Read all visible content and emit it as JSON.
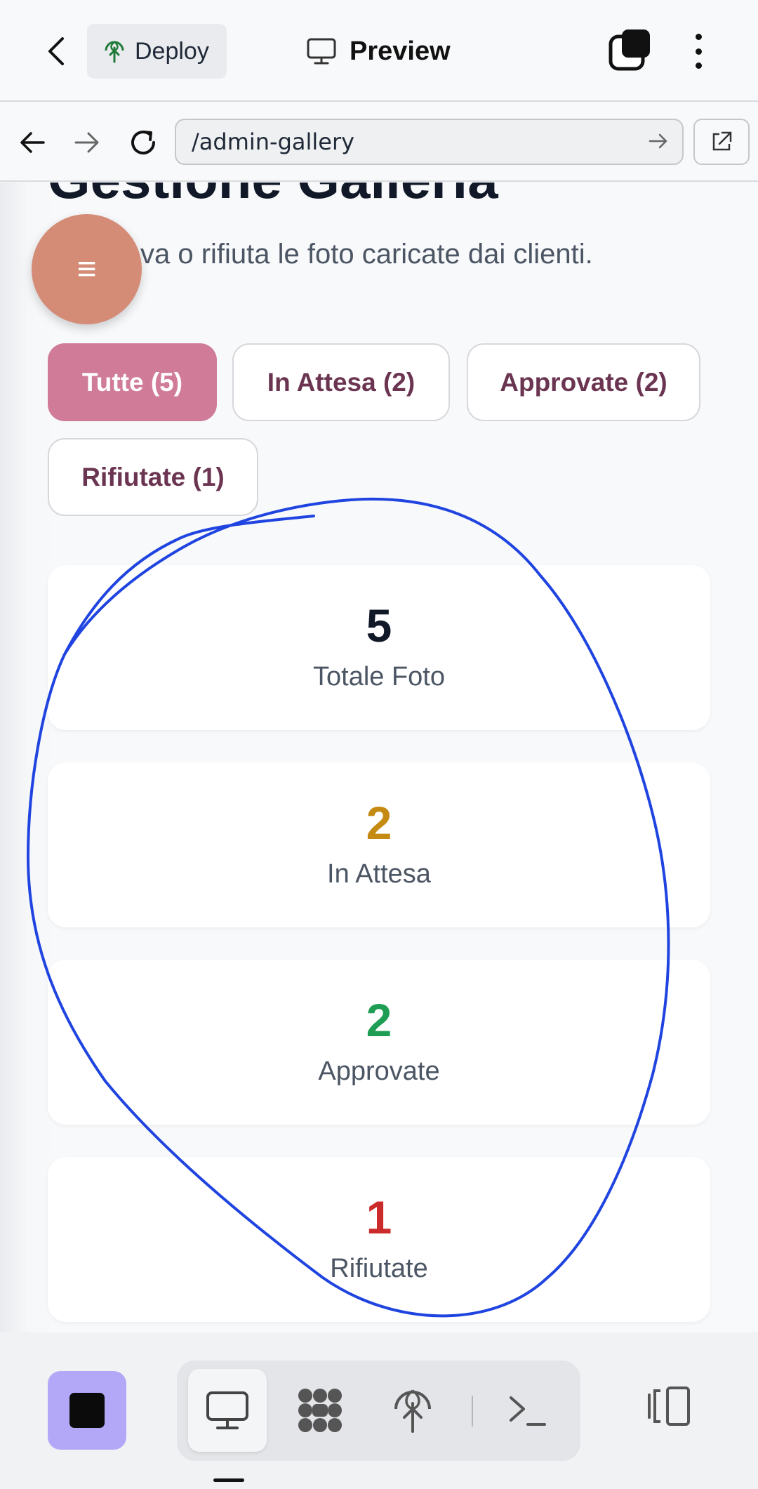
{
  "appbar": {
    "deploy_label": "Deploy",
    "preview_label": "Preview"
  },
  "urlbar": {
    "url": "/admin-gallery"
  },
  "page": {
    "title": "Gestione Galleria",
    "subtitle_visible": "va o rifiuta le foto caricate dai clienti."
  },
  "filters": [
    {
      "label": "Tutte (5)",
      "active": true
    },
    {
      "label": "In Attesa (2)",
      "active": false
    },
    {
      "label": "Approvate (2)",
      "active": false
    },
    {
      "label": "Rifiutate (1)",
      "active": false
    }
  ],
  "stats": [
    {
      "value": "5",
      "label": "Totale Foto",
      "color": "#111827"
    },
    {
      "value": "2",
      "label": "In Attesa",
      "color": "#c48a12"
    },
    {
      "value": "2",
      "label": "Approvate",
      "color": "#1f9d55"
    },
    {
      "value": "1",
      "label": "Rifiutate",
      "color": "#cc2b2b"
    }
  ],
  "colors": {
    "accent_pink": "#d07c99",
    "fab": "#d48c77",
    "annotation": "#1f44e0",
    "stop_button": "#b2a8f7"
  },
  "icons": {
    "menu": "≡",
    "terminal": ">_"
  }
}
